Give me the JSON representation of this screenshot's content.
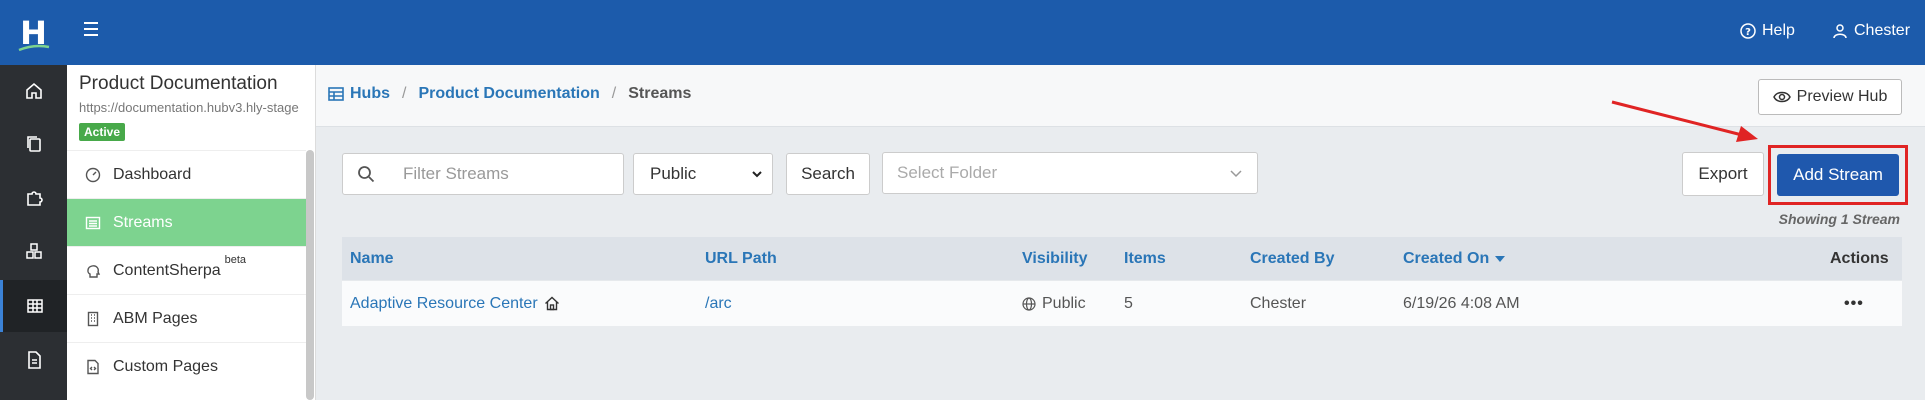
{
  "rail": {
    "logo_letter": "H",
    "items": [
      {
        "icon": "home-icon"
      },
      {
        "icon": "copy-icon"
      },
      {
        "icon": "puzzle-icon"
      },
      {
        "icon": "cubes-icon"
      },
      {
        "icon": "grid-icon",
        "active": true
      },
      {
        "icon": "document-icon"
      }
    ]
  },
  "topbar": {
    "help_label": "Help",
    "user_label": "Chester"
  },
  "hub": {
    "title": "Product Documentation",
    "url": "https://documentation.hubv3.hly-stage",
    "status": "Active"
  },
  "sidebar": {
    "items": [
      {
        "label": "Dashboard",
        "icon": "gauge-icon"
      },
      {
        "label": "Streams",
        "icon": "list-icon",
        "active": true
      },
      {
        "label": "ContentSherpa",
        "badge": "beta",
        "icon": "brain-icon"
      },
      {
        "label": "ABM Pages",
        "icon": "building-icon"
      },
      {
        "label": "Custom Pages",
        "icon": "code-file-icon"
      }
    ]
  },
  "breadcrumb": {
    "root": "Hubs",
    "hub": "Product Documentation",
    "current": "Streams",
    "separator": "/"
  },
  "header": {
    "preview_label": "Preview Hub"
  },
  "filters": {
    "search_placeholder": "Filter Streams",
    "visibility_selected": "Public",
    "search_label": "Search",
    "folder_placeholder": "Select Folder"
  },
  "actions": {
    "export_label": "Export",
    "add_label": "Add Stream",
    "showing_text": "Showing 1 Stream"
  },
  "table": {
    "headers": {
      "name": "Name",
      "url": "URL Path",
      "visibility": "Visibility",
      "items": "Items",
      "created_by": "Created By",
      "created_on": "Created On",
      "actions": "Actions"
    },
    "rows": [
      {
        "name": "Adaptive Resource Center",
        "url": "/arc",
        "visibility": "Public",
        "items": "5",
        "created_by": "Chester",
        "created_on": "6/19/26 4:08 AM",
        "actions": "•••"
      }
    ]
  },
  "colors": {
    "brand_blue": "#1c5bab",
    "active_green": "#7dd38f",
    "highlight_red": "#e02424"
  }
}
